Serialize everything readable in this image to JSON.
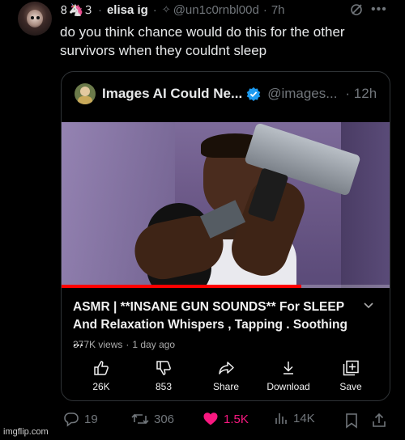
{
  "post": {
    "author_glyphs": "𝟾🦄𝟹",
    "author_name": "elisa ig",
    "handle": "@un1c0rnbl00d",
    "time": "7h",
    "text": "do you think chance would do this for the other survivors when they couldnt sleep"
  },
  "quote": {
    "author_name": "Images AI Could Ne...",
    "handle": "@images...",
    "time": "· 12h",
    "video": {
      "title": "ASMR | **INSANE GUN SOUNDS**  For SLEEP And Relaxation Whispers , Tapping . Soothing ...",
      "views": "377K views",
      "age": "1 day ago",
      "progress_percent": 73,
      "actions": [
        {
          "icon": "thumbs-up-icon",
          "label": "26K"
        },
        {
          "icon": "thumbs-down-icon",
          "label": "853"
        },
        {
          "icon": "share-icon",
          "label": "Share"
        },
        {
          "icon": "download-icon",
          "label": "Download"
        },
        {
          "icon": "save-icon",
          "label": "Save"
        }
      ]
    }
  },
  "stats": {
    "replies": "19",
    "reposts": "306",
    "likes": "1.5K",
    "views": "14K"
  },
  "colors": {
    "background": "#000000",
    "text": "#e7e9ea",
    "muted": "#71767b",
    "like": "#f91880",
    "verified": "#1d9bf0",
    "progress": "#ff0000"
  },
  "watermark": "imgflip.com"
}
